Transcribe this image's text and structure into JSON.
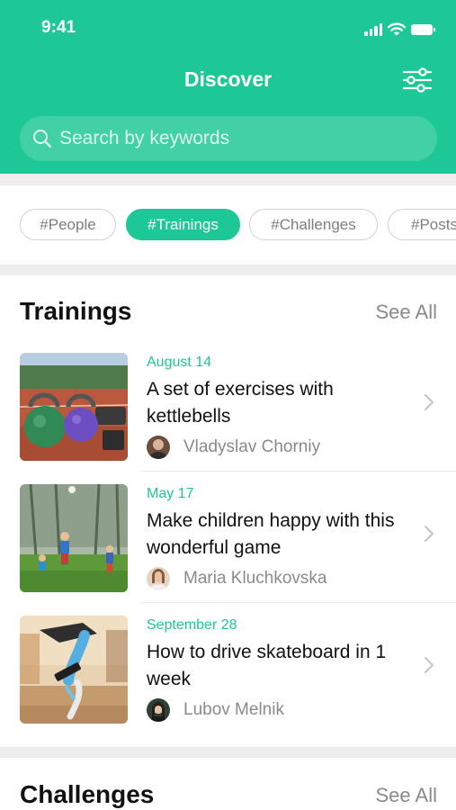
{
  "status_bar": {
    "time": "9:41"
  },
  "nav": {
    "title": "Discover"
  },
  "search": {
    "placeholder": "Search by keywords"
  },
  "tags": [
    "#People",
    "#Trainings",
    "#Challenges",
    "#Posts"
  ],
  "active_tag": "#Trainings",
  "trainings": {
    "title": "Trainings",
    "see_all": "See All",
    "items": [
      {
        "date": "August 14",
        "title": "A set of exercises with kettlebells",
        "author": "Vladyslav Chorniy"
      },
      {
        "date": "May 17",
        "title": "Make children happy with this wonderful game",
        "author": "Maria Kluchkovska"
      },
      {
        "date": "September 28",
        "title": "How to drive skateboard in 1 week",
        "author": "Lubov Melnik"
      }
    ]
  },
  "challenges": {
    "title": "Challenges",
    "see_all": "See All"
  },
  "colors": {
    "accent": "#1ec896",
    "muted_text": "#8a8a8a",
    "separator": "#ededed"
  },
  "icons": [
    "search-icon",
    "filter-sliders-icon",
    "chevron-right-icon",
    "signal-icon",
    "wifi-icon",
    "battery-icon"
  ]
}
